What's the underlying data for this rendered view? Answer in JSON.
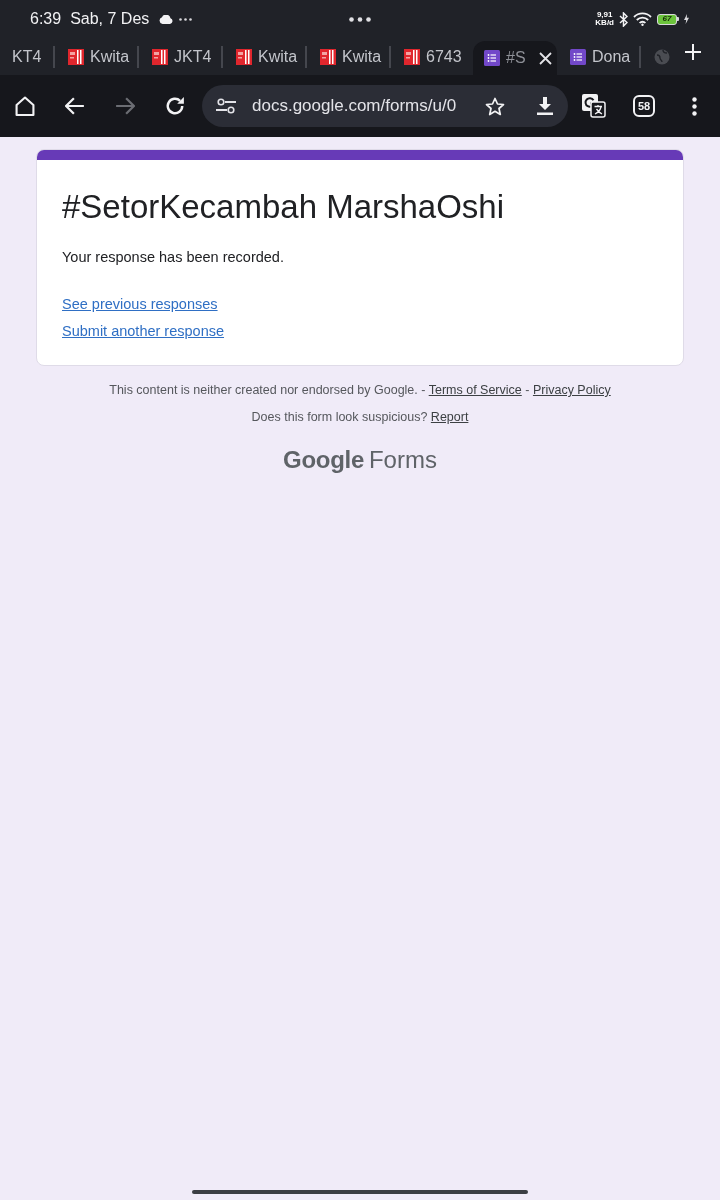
{
  "status_bar": {
    "time": "6:39",
    "date": "Sab, 7 Des",
    "net_speed": {
      "value": "9,91",
      "unit": "KB/d"
    },
    "battery": "67",
    "charging": true
  },
  "tabs": [
    {
      "label": "KT4",
      "kind": "plain",
      "selected": false
    },
    {
      "label": "Kwita",
      "kind": "receipt",
      "selected": false
    },
    {
      "label": "JKT4",
      "kind": "receipt",
      "selected": false
    },
    {
      "label": "Kwita",
      "kind": "receipt",
      "selected": false
    },
    {
      "label": "Kwita",
      "kind": "receipt",
      "selected": false
    },
    {
      "label": "6743",
      "kind": "receipt",
      "selected": false
    },
    {
      "label": "#S",
      "kind": "forms",
      "selected": true
    },
    {
      "label": "Dona",
      "kind": "forms",
      "selected": false
    },
    {
      "kind": "globe",
      "selected": false
    }
  ],
  "toolbar": {
    "forward_disabled": true,
    "url": "docs.google.com/forms/u/0",
    "tab_count": "58"
  },
  "form": {
    "title": "#SetorKecambah MarshaOshi",
    "message": "Your response has been recorded.",
    "links": [
      "See previous responses",
      "Submit another response"
    ]
  },
  "footer": {
    "lines": [
      [
        {
          "kind": "text",
          "text": "This content is neither created nor endorsed by Google."
        },
        {
          "kind": "text",
          "text": "-"
        },
        {
          "kind": "link",
          "text": "Terms of Service"
        },
        {
          "kind": "text",
          "text": "-"
        },
        {
          "kind": "link",
          "text": "Privacy Policy"
        }
      ],
      [
        {
          "kind": "text",
          "text": "Does this form look suspicious?"
        },
        {
          "kind": "link",
          "text": "Report"
        }
      ]
    ],
    "logo": {
      "brand": "Google",
      "product": "Forms"
    }
  }
}
